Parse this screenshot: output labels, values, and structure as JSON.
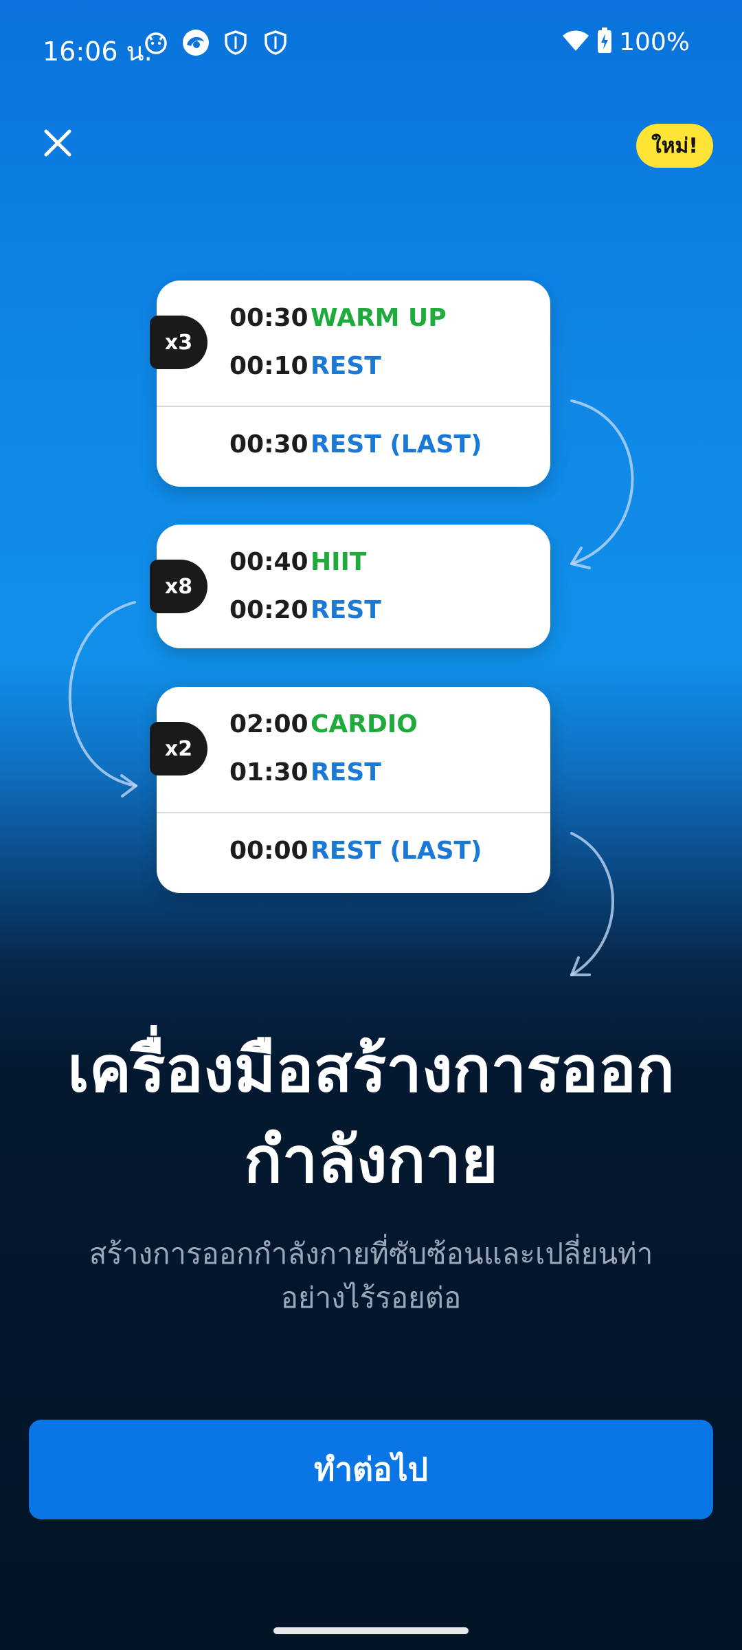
{
  "status_bar": {
    "time": "16:06 น.",
    "battery": "100%",
    "icons": [
      "cat-notification-icon",
      "browser-icon",
      "shield-icon",
      "shield-icon",
      "wifi-icon",
      "battery-charging-icon"
    ]
  },
  "header": {
    "close_icon": "close-icon",
    "badge": "ใหม่!"
  },
  "cards": [
    {
      "repeat": "x3",
      "rows": [
        {
          "time": "00:30",
          "label": "WARM UP",
          "color": "#1eab3c"
        },
        {
          "time": "00:10",
          "label": "REST",
          "color": "#1a79d6"
        }
      ],
      "last": {
        "time": "00:30",
        "label": "REST (LAST)",
        "color": "#1a79d6"
      }
    },
    {
      "repeat": "x8",
      "rows": [
        {
          "time": "00:40",
          "label": "HIIT",
          "color": "#1eab3c"
        },
        {
          "time": "00:20",
          "label": "REST",
          "color": "#1a79d6"
        }
      ]
    },
    {
      "repeat": "x2",
      "rows": [
        {
          "time": "02:00",
          "label": "CARDIO",
          "color": "#1eab3c"
        },
        {
          "time": "01:30",
          "label": "REST",
          "color": "#1a79d6"
        }
      ],
      "last": {
        "time": "00:00",
        "label": "REST (LAST)",
        "color": "#1a79d6"
      }
    }
  ],
  "title_line1": "เครื่องมือสร้างการออก",
  "title_line2": "กำลังกาย",
  "subtitle_line1": "สร้างการออกกำลังกายที่ซับซ้อนและเปลี่ยนท่า",
  "subtitle_line2": "อย่างไร้รอยต่อ",
  "continue_label": "ทำต่อไป",
  "colors": {
    "accent": "#0a76e6",
    "badge": "#ffe335",
    "work_label": "#1eab3c",
    "rest_label": "#1a79d6"
  }
}
